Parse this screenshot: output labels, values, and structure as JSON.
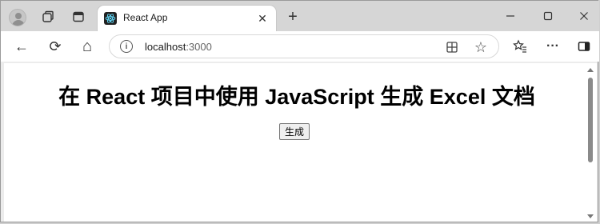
{
  "browser": {
    "tab": {
      "title": "React App",
      "favicon": "react-icon"
    },
    "address_bar": {
      "host": "localhost",
      "port": ":3000"
    },
    "icons": {
      "profile": "profile-icon",
      "workspaces": "workspaces-icon",
      "tab_actions": "tab-actions-icon",
      "close_tab": "close-icon",
      "new_tab": "plus-icon",
      "minimize": "minimize-icon",
      "maximize": "maximize-icon",
      "close_window": "close-icon",
      "back": "back-arrow-icon",
      "refresh": "refresh-icon",
      "home": "home-icon",
      "info": "info-icon",
      "reader": "reader-mode-icon",
      "favorite": "star-icon",
      "favorites": "favorites-icon",
      "more": "more-icon",
      "sidebar": "sidebar-icon"
    },
    "glyphs": {
      "close": "✕",
      "plus": "+",
      "back": "←",
      "refresh": "⟳",
      "home": "⌂",
      "info": "i",
      "star": "☆",
      "more": "···"
    }
  },
  "page": {
    "heading": "在 React 项目中使用 JavaScript 生成 Excel 文档",
    "button_label": "生成"
  }
}
